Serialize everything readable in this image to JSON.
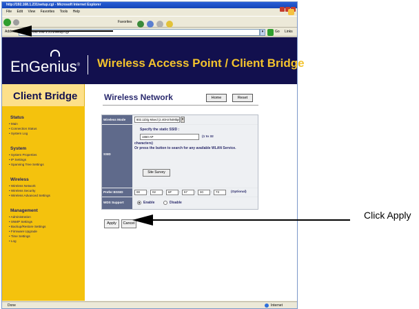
{
  "browser": {
    "title": "http://192.168.1.231/setup.cgi - Microsoft Internet Explorer",
    "menu": [
      "File",
      "Edit",
      "View",
      "Favorites",
      "Tools",
      "Help"
    ],
    "toolbar_favorites": "Favorites",
    "address_label": "Address",
    "address_url": "http://192.168.1.231/setup.cgi",
    "go_label": "Go",
    "links_label": "Links",
    "status_left": "Done",
    "status_zone": "Internet"
  },
  "header": {
    "logo_text": "EnGenius",
    "logo_mark": "®",
    "title": "Wireless Access Point / Client Bridge"
  },
  "sidebar": {
    "title": "Client Bridge",
    "groups": [
      {
        "label": "Status",
        "items": [
          "Main",
          "Connection Status",
          "System Log"
        ]
      },
      {
        "label": "System",
        "items": [
          "System Properties",
          "IP Settings",
          "Spanning Tree Settings"
        ]
      },
      {
        "label": "Wireless",
        "items": [
          "Wireless Network",
          "Wireless Security",
          "Wireless Advanced Settings"
        ]
      },
      {
        "label": "Management",
        "items": [
          "Administration",
          "SNMP Settings",
          "Backup/Restore Settings",
          "Firmware Upgrade",
          "Time Settings",
          "Log"
        ]
      }
    ]
  },
  "main": {
    "title": "Wireless Network",
    "home_button": "Home",
    "reset_button": "Reset",
    "form": {
      "wireless_mode_label": "Wireless Mode",
      "wireless_mode_value": "802.11b/g Mixed (2.4GHz/54Mbps)",
      "ssid_label": "SSID",
      "ssid_hint": "Specify the static SSID :",
      "ssid_value": "1650 AP",
      "ssid_range": "(1 to 32",
      "ssid_range_tail": "characters)",
      "ssid_or_text": "Or press the button to search for any available WLAN Service.",
      "site_survey_button": "Site Survey",
      "bssid_label": "Prefer BSSID",
      "bssid_values": [
        "00",
        "02",
        "6F",
        "57",
        "3C",
        "73"
      ],
      "bssid_optional": "(Optional)",
      "wds_label": "WDS Support",
      "wds_enable": "Enable",
      "wds_disable": "Disable"
    },
    "apply_button": "Apply",
    "cancel_button": "Cancel"
  },
  "annotation": {
    "callout": "Click Apply"
  },
  "colors": {
    "header_bg": "#12104e",
    "header_title": "#f3c32d",
    "sidebar_bg": "#f4c20d",
    "label_bg": "#5f6a8b"
  }
}
